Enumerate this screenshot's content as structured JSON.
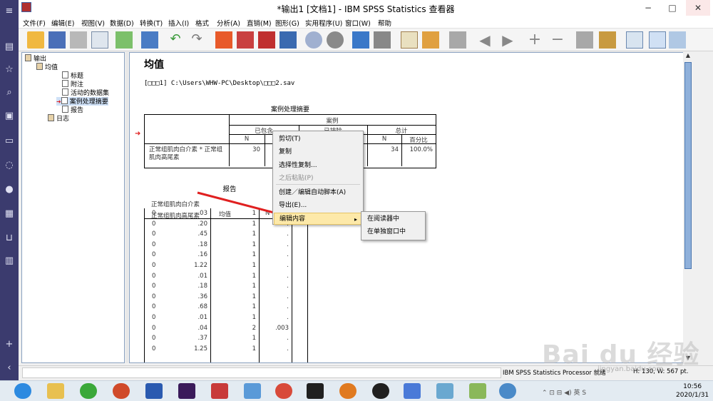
{
  "window": {
    "title": "*输出1 [文档1] - IBM SPSS Statistics 查看器"
  },
  "menubar": [
    "文件(F)",
    "编辑(E)",
    "视图(V)",
    "数据(D)",
    "转换(T)",
    "插入(I)",
    "格式",
    "分析(A)",
    "直销(M)",
    "图形(G)",
    "实用程序(U)",
    "窗口(W)",
    "帮助"
  ],
  "nav_tree": {
    "root": "输出",
    "mean": "均值",
    "children": [
      "标题",
      "附注",
      "活动的数据集",
      "案例处理摘要",
      "报告"
    ],
    "log": "日志"
  },
  "output": {
    "heading": "均值",
    "filepath": "[□□□1] C:\\Users\\WHW-PC\\Desktop\\□□□2.sav",
    "case_summary": {
      "title": "案例处理摘要",
      "group_header": "案例",
      "col_included": "已包含",
      "col_excluded": "已排除",
      "col_total": "总计",
      "col_n": "N",
      "col_pct": "百分比",
      "row_label": "正常组肌肉白介素 * 正常组肌肉高尾素",
      "included_n": "30",
      "total_n": "34",
      "total_pct": "100.0%"
    },
    "report": {
      "title": "报告",
      "subtitle": "正常组肌肉白介素",
      "col_group": "正常组肌肉高尾素",
      "col_mean": "均值",
      "col_n": "N",
      "rows": [
        {
          "g": "0",
          "mean": ".03",
          "n": "1",
          "sd": "."
        },
        {
          "g": "0",
          "mean": ".20",
          "n": "1",
          "sd": "."
        },
        {
          "g": "0",
          "mean": ".45",
          "n": "1",
          "sd": "."
        },
        {
          "g": "0",
          "mean": ".18",
          "n": "1",
          "sd": "."
        },
        {
          "g": "0",
          "mean": ".16",
          "n": "1",
          "sd": "."
        },
        {
          "g": "0",
          "mean": "1.22",
          "n": "1",
          "sd": "."
        },
        {
          "g": "0",
          "mean": ".01",
          "n": "1",
          "sd": "."
        },
        {
          "g": "0",
          "mean": ".18",
          "n": "1",
          "sd": "."
        },
        {
          "g": "0",
          "mean": ".36",
          "n": "1",
          "sd": "."
        },
        {
          "g": "0",
          "mean": ".68",
          "n": "1",
          "sd": "."
        },
        {
          "g": "0",
          "mean": ".01",
          "n": "1",
          "sd": "."
        },
        {
          "g": "0",
          "mean": ".04",
          "n": "2",
          "sd": ".003"
        },
        {
          "g": "0",
          "mean": ".37",
          "n": "1",
          "sd": "."
        },
        {
          "g": "0",
          "mean": "1.25",
          "n": "1",
          "sd": "."
        }
      ]
    }
  },
  "context_menu": {
    "items": [
      {
        "label": "剪切(T)",
        "disabled": false
      },
      {
        "label": "复制",
        "disabled": false
      },
      {
        "label": "选择性复制...",
        "disabled": false
      },
      {
        "label": "之后粘贴(P)",
        "disabled": true
      },
      {
        "label": "创建／编辑自动脚本(A)",
        "disabled": false
      },
      {
        "label": "导出(E)...",
        "disabled": false
      },
      {
        "label": "编辑内容",
        "disabled": false,
        "submenu": true
      }
    ],
    "submenu": [
      "在阅读器中",
      "在单独窗口中"
    ]
  },
  "status": {
    "processor": "IBM SPSS Statistics Processor 就绪",
    "size": "H: 130, W: 567 pt."
  },
  "watermark": "Bai du 经验",
  "watermark_url": "jingyan.baidu.com",
  "clock": {
    "time": "10:56",
    "date": "2020/1/31"
  },
  "colors": {
    "selection": "#fde9a9",
    "annotation_arrow": "#e02020",
    "sidebar": "#3b3b6e"
  }
}
